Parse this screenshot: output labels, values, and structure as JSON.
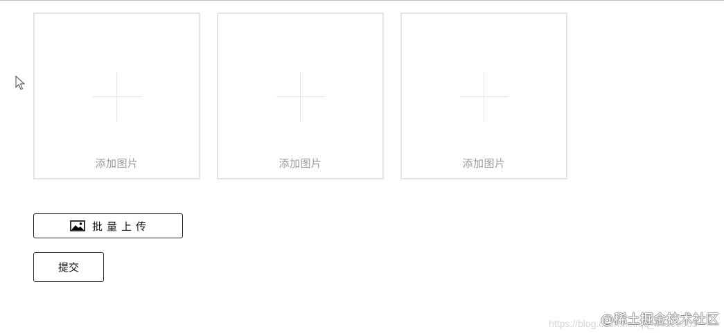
{
  "upload_tiles": [
    {
      "label": "添加图片",
      "icon": "plus-icon"
    },
    {
      "label": "添加图片",
      "icon": "plus-icon"
    },
    {
      "label": "添加图片",
      "icon": "plus-icon"
    }
  ],
  "batch_upload": {
    "label": "批量上传",
    "icon": "image-icon"
  },
  "submit": {
    "label": "提交"
  },
  "watermark": {
    "url": "https://blog.csdn.net/qq_37135955",
    "brand": "@稀土掘金技术社区"
  },
  "colors": {
    "tile_border": "#e4e4e4",
    "placeholder_text": "#9a9a9a",
    "button_border": "#222222"
  }
}
